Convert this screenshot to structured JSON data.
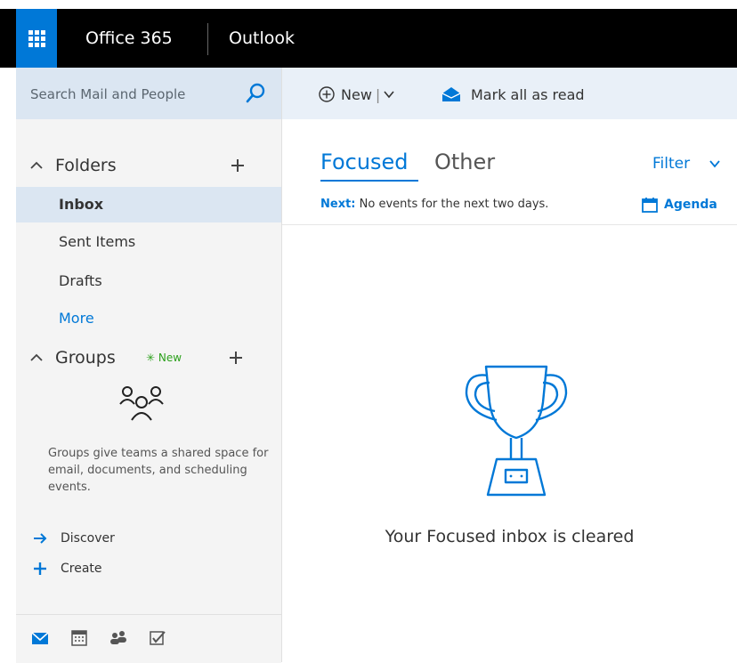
{
  "header": {
    "brand": "Office 365",
    "app_name": "Outlook",
    "waffle_icon": "app-launcher-icon",
    "accent": "#0078d7"
  },
  "search": {
    "placeholder": "Search Mail and People",
    "icon": "search-icon"
  },
  "folders": {
    "heading": "Folders",
    "items": [
      "Inbox",
      "Sent Items",
      "Drafts"
    ],
    "selected": "Inbox",
    "more_label": "More"
  },
  "groups": {
    "heading": "Groups",
    "new_badge": "New",
    "description": "Groups give teams a shared space for email, documents, and scheduling events.",
    "actions": [
      {
        "label": "Discover",
        "icon": "arrow-right-icon"
      },
      {
        "label": "Create",
        "icon": "plus-icon"
      }
    ]
  },
  "bottom_nav": [
    "mail-icon",
    "calendar-icon",
    "people-icon",
    "tasks-icon"
  ],
  "toolbar": {
    "new_label": "New",
    "separator": "|",
    "mark_all_read_label": "Mark all as read"
  },
  "message_list": {
    "tabs": [
      "Focused",
      "Other"
    ],
    "active_tab": "Focused",
    "filter_label": "Filter",
    "next_label": "Next:",
    "next_text": "No events for the next two days.",
    "agenda_label": "Agenda",
    "empty_message": "Your Focused inbox is cleared"
  }
}
